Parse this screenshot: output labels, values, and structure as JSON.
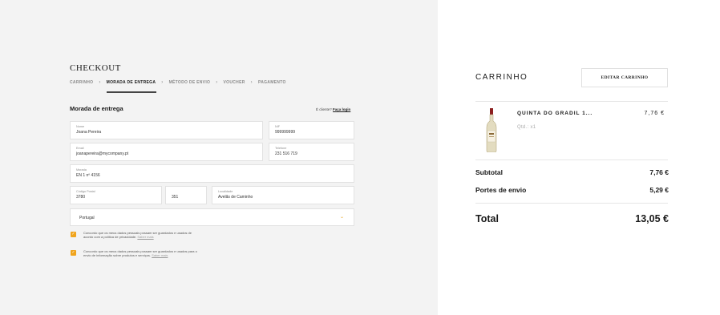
{
  "checkout": {
    "title": "CHECKOUT",
    "steps": [
      "CARRINHO",
      "MORADA DE ENTREGA",
      "MÉTODO DE ENVIO",
      "VOUCHER",
      "PAGAMENTO"
    ],
    "active_step": "MORADA DE ENTREGA"
  },
  "shipping": {
    "section_title": "Morada de entrega",
    "login_hint": "É cliente?",
    "login_link": "Faça login",
    "fields": {
      "nome": {
        "label": "Nome",
        "value": "Joana Pereira"
      },
      "nif": {
        "label": "NIF",
        "value": "999999999"
      },
      "email": {
        "label": "Email",
        "value": "joanapereira@mycompany.pt"
      },
      "telefone": {
        "label": "Telefone",
        "value": "231 516 719"
      },
      "morada": {
        "label": "Morada",
        "value": "EN 1 nº 4156"
      },
      "codigo_postal": {
        "label": "Código Postal",
        "value": "3780"
      },
      "codigo_postal_ext": {
        "label": "",
        "value": "351"
      },
      "localidade": {
        "label": "Localidade",
        "value": "Avelãs de Caminho"
      }
    },
    "country": "Portugal",
    "consents": [
      {
        "text": "Concordo que os meus dados pessoais possam ser guardados e usados de acordo com a política de privacidade.",
        "link": "Saber mais",
        "checked": true
      },
      {
        "text": "Concordo que os meus dados pessoais possam ser guardados e usados para o envio de informação sobre produtos e serviços.",
        "link": "Saber mais",
        "checked": true
      }
    ]
  },
  "cart": {
    "title": "CARRINHO",
    "edit_label": "EDITAR CARRINHO",
    "product": {
      "name": "QUINTA DO GRADIL 1...",
      "qty": "Qtd.: x1",
      "price": "7,76 €"
    },
    "subtotal_label": "Subtotal",
    "subtotal_value": "7,76 €",
    "shipping_label": "Portes de envio",
    "shipping_value": "5,29 €",
    "total_label": "Total",
    "total_value": "13,05 €"
  },
  "colors": {
    "accent": "#f0a41c",
    "panel_bg": "#f3f3f3"
  }
}
